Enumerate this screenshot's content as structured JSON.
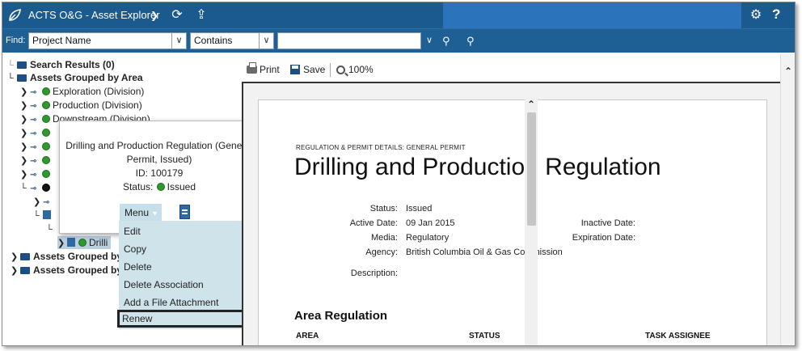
{
  "titlebar": {
    "app_title": "ACTS O&G - Asset Explorer",
    "chevron_icon": "chevron-down-icon",
    "refresh_icon": "refresh-icon",
    "export_icon": "upload-icon",
    "settings_icon": "gear-icon",
    "help_label": "?"
  },
  "findbar": {
    "find_label": "Find:",
    "field_value": "Project Name",
    "operator_value": "Contains",
    "search_value": "",
    "search_icon": "search-icon",
    "advanced_search_icon": "advanced-search-icon"
  },
  "tree": {
    "search_results": "Search Results (0)",
    "assets_by_area": "Assets Grouped by Area",
    "divisions": [
      "Exploration (Division)",
      "Production (Division)",
      "Downstream (Division)"
    ],
    "drill_item": "Drilli",
    "group_b": "Assets Grouped by",
    "group_c": "Assets Grouped by"
  },
  "popup": {
    "title_line1": "Drilling and Production Regulation (General",
    "title_line2": "Permit, Issued)",
    "id_line": "ID: 100179",
    "status_label": "Status:",
    "status_value": "Issued",
    "close": "×",
    "menu_label": "Menu"
  },
  "menu": {
    "items": [
      "Edit",
      "Copy",
      "Delete",
      "Delete Association",
      "Add a File Attachment",
      "Renew"
    ]
  },
  "toolbar": {
    "print": "Print",
    "save": "Save",
    "zoom": "100%"
  },
  "document": {
    "kicker": "REGULATION & PERMIT DETAILS: GENERAL PERMIT",
    "title": "Drilling and Production Regulation",
    "fields": {
      "status_label": "Status:",
      "status_value": "Issued",
      "active_label": "Active Date:",
      "active_value": "09 Jan 2015",
      "media_label": "Media:",
      "media_value": "Regulatory",
      "agency_label": "Agency:",
      "agency_value": "British Columbia Oil & Gas Commission",
      "description_label": "Description:",
      "inactive_label": "Inactive Date:",
      "expiration_label": "Expiration Date:"
    },
    "section_title": "Area Regulation",
    "columns": [
      "AREA",
      "STATUS",
      "TASK ASSIGNEE"
    ]
  },
  "colors": {
    "titlebar": "#1b5a8e",
    "findbar": "#1e5f94",
    "menu_bg": "#cfe3ea",
    "status_green": "#2e9a2e"
  }
}
